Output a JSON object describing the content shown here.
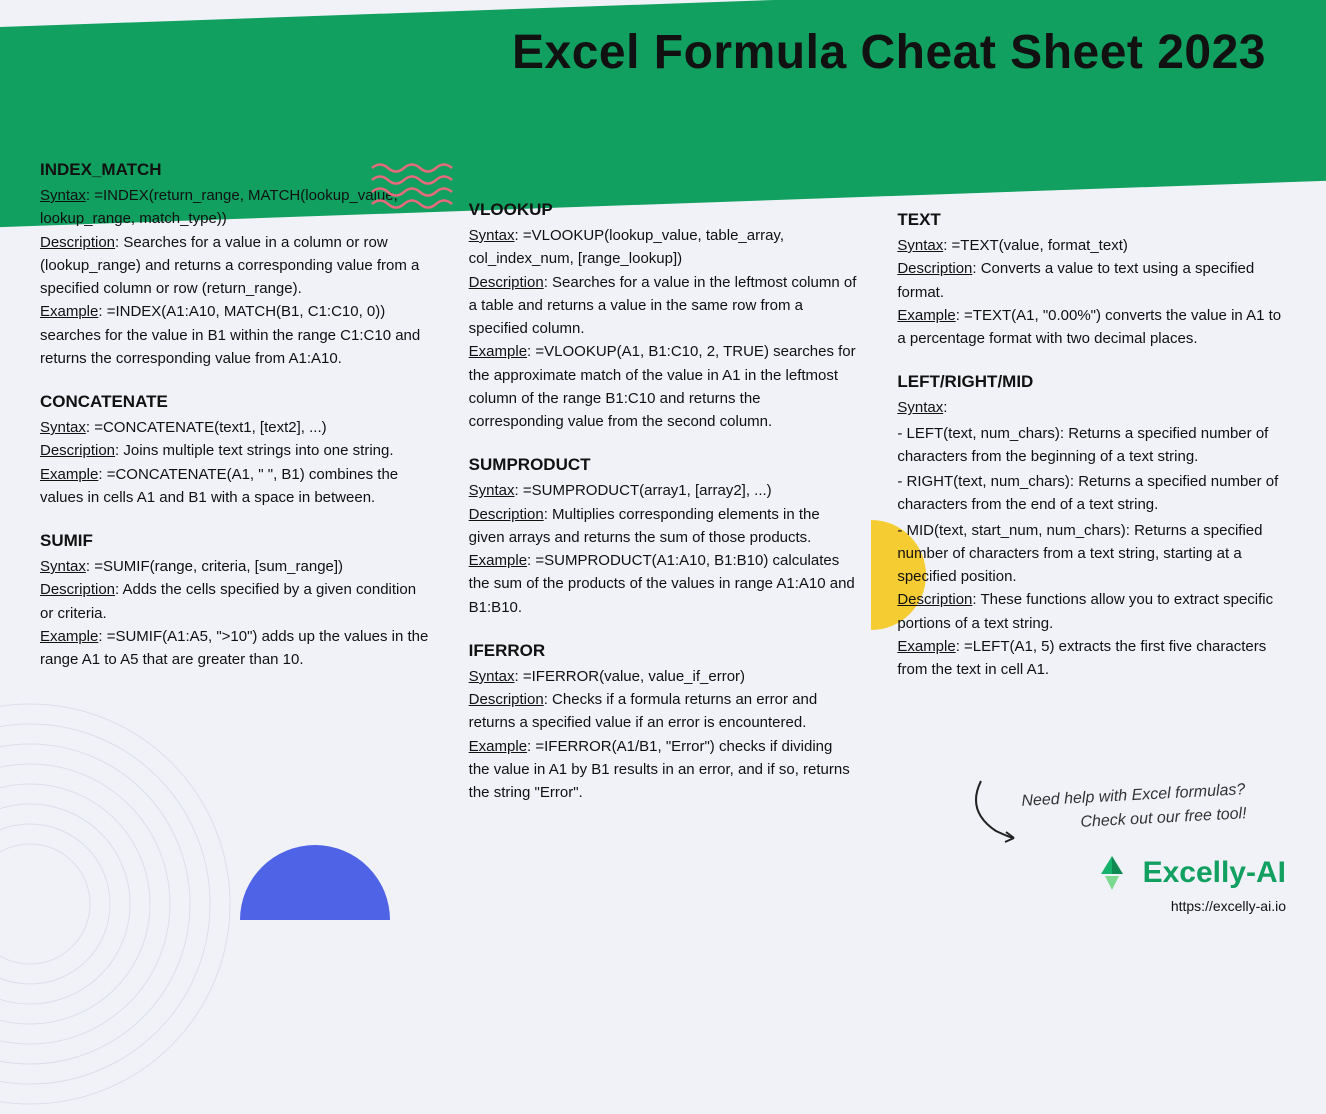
{
  "title": "Excel Formula Cheat Sheet 2023",
  "labels": {
    "syntax": "Syntax",
    "description": "Description",
    "example": "Example"
  },
  "col1": [
    {
      "name": "INDEX_MATCH",
      "syntax": "=INDEX(return_range, MATCH(lookup_value, lookup_range, match_type))",
      "description": "Searches for a value in a column or row (lookup_range) and returns a corresponding value from a specified column or row (return_range).",
      "example": "=INDEX(A1:A10, MATCH(B1, C1:C10, 0)) searches for the value in B1 within the range C1:C10 and returns the corresponding value from A1:A10."
    },
    {
      "name": "CONCATENATE",
      "syntax": "=CONCATENATE(text1, [text2], ...)",
      "description": "Joins multiple text strings into one string.",
      "example": "=CONCATENATE(A1, \" \", B1) combines the values in cells A1 and B1 with a space in between."
    },
    {
      "name": "SUMIF",
      "syntax": "=SUMIF(range, criteria, [sum_range])",
      "description": "Adds the cells specified by a given condition or criteria.",
      "example": "=SUMIF(A1:A5, \">10\") adds up the values in the range A1 to A5 that are greater than 10."
    }
  ],
  "col2": [
    {
      "name": "VLOOKUP",
      "syntax": "=VLOOKUP(lookup_value, table_array, col_index_num, [range_lookup])",
      "description": "Searches for a value in the leftmost column of a table and returns a value in the same row from a specified column.",
      "example": "=VLOOKUP(A1, B1:C10, 2, TRUE) searches for the approximate match of the value in A1 in the leftmost column of the range B1:C10 and returns the corresponding value from the second column."
    },
    {
      "name": "SUMPRODUCT",
      "syntax": "=SUMPRODUCT(array1, [array2], ...)",
      "description": "Multiplies corresponding elements in the given arrays and returns the sum of those products.",
      "example": "=SUMPRODUCT(A1:A10, B1:B10) calculates the sum of the products of the values in range A1:A10 and B1:B10."
    },
    {
      "name": "IFERROR",
      "syntax": "=IFERROR(value, value_if_error)",
      "description": "Checks if a formula returns an error and returns a specified value if an error is encountered.",
      "example": "=IFERROR(A1/B1, \"Error\") checks if dividing the value in A1 by B1 results in an error, and if so, returns the string \"Error\"."
    }
  ],
  "col3": [
    {
      "name": "TEXT",
      "syntax": "=TEXT(value, format_text)",
      "description": "Converts a value to text using a specified format.",
      "example": "=TEXT(A1, \"0.00%\") converts the value in A1 to a percentage format with two decimal places."
    },
    {
      "name": "LEFT/RIGHT/MID",
      "syntax_multi": [
        "- LEFT(text, num_chars): Returns a specified number of characters from the beginning of a text string.",
        "- RIGHT(text, num_chars): Returns a specified number of characters from the end of a text string.",
        "- MID(text, start_num, num_chars): Returns a specified number of characters from a text string, starting at a specified position."
      ],
      "description": "These functions allow you to extract specific portions of a text string.",
      "example": "=LEFT(A1, 5) extracts the first five characters from the text in cell A1."
    }
  ],
  "cta": {
    "line1": "Need help with Excel formulas?",
    "line2": "Check out our free tool!",
    "brand": "Excelly-AI",
    "url": "https://excelly-ai.io"
  }
}
